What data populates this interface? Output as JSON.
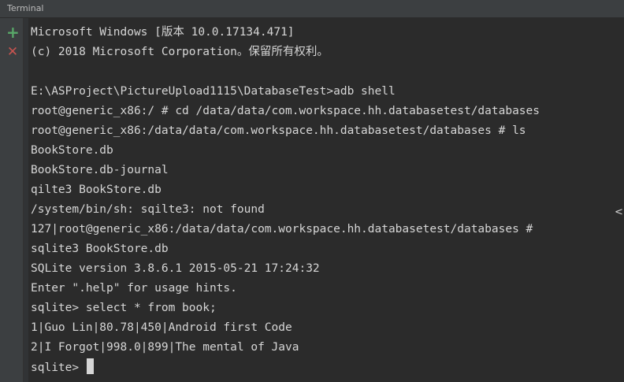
{
  "window": {
    "title": "Terminal"
  },
  "toolbar": {
    "new_session_icon": "plus-icon",
    "close_session_icon": "close-icon"
  },
  "terminal": {
    "lines": [
      "Microsoft Windows [版本 10.0.17134.471]",
      "(c) 2018 Microsoft Corporation。保留所有权利。",
      "",
      "E:\\ASProject\\PictureUpload1115\\DatabaseTest>adb shell",
      "root@generic_x86:/ # cd /data/data/com.workspace.hh.databasetest/databases",
      "root@generic_x86:/data/data/com.workspace.hh.databasetest/databases # ls",
      "BookStore.db",
      "BookStore.db-journal",
      "qilte3 BookStore.db",
      "/system/bin/sh: sqilte3: not found",
      "127|root@generic_x86:/data/data/com.workspace.hh.databasetest/databases #",
      "sqlite3 BookStore.db",
      "SQLite version 3.8.6.1 2015-05-21 17:24:32",
      "Enter \".help\" for usage hints.",
      "sqlite> select * from book;",
      "1|Guo Lin|80.78|450|Android first Code",
      "2|I Forgot|998.0|899|The mental of Java"
    ],
    "prompt": "sqlite> ",
    "scroll_marker": "<"
  },
  "colors": {
    "background": "#2b2b2b",
    "text": "#d6d6d6",
    "toolbar": "#3c3f41",
    "add": "#59a869",
    "close": "#c75450"
  }
}
